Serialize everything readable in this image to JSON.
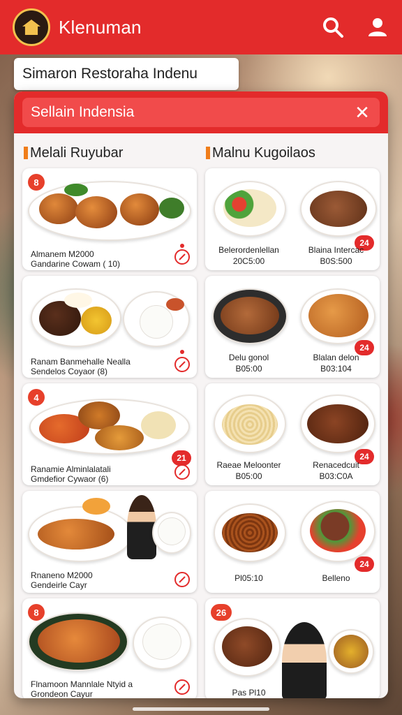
{
  "header": {
    "title": "Klenuman"
  },
  "banner": {
    "text": "Simaron Restoraha Indenu"
  },
  "modal": {
    "title": "Sellain Indensia",
    "close_icon": "close-icon"
  },
  "columns": [
    {
      "title": "Melali Ruyubar"
    },
    {
      "title": "Malnu Kugoilaos"
    }
  ],
  "left_cards": [
    {
      "badge": "8",
      "line1": "Almanem M2000",
      "line2": "Gandarine Cowam ( 10)"
    },
    {
      "badge": "",
      "line1": "Ranam Banmehalle Nealla",
      "line2": "Sendelos Coyaor (8)"
    },
    {
      "badge": "4",
      "line1": "Ranamie Alminlalatali",
      "line2": "Gmdefior Cywaor (6)"
    },
    {
      "badge": "",
      "line1": "Rnaneno M2000",
      "line2": "Gendeirle Cayr"
    },
    {
      "badge": "8",
      "line1": "Flnamoon Mannlale Ntyid a",
      "line2": "Grondeon Cayur"
    }
  ],
  "right_cards": [
    {
      "badge": "",
      "line1": "Belerordenlellan",
      "line2": "20C5:00",
      "line3": "Blaina Intercac",
      "line4": "B0S:500",
      "rbadge": "24"
    },
    {
      "badge": "",
      "line1": "Delu gonol",
      "line2": "B05:00",
      "line3": "Blalan delon",
      "line4": "B03:104",
      "rbadge": "24"
    },
    {
      "badge": "",
      "line1": "Raeae Meloonter",
      "line2": "B05:00",
      "line3": "Renacedcuit",
      "line4": "B03:C0A",
      "rbadge": "24"
    },
    {
      "badge": "",
      "line1": "Pl05:10",
      "line2": "",
      "line3": "Belleno",
      "line4": "",
      "rbadge": "24"
    },
    {
      "badge": "26",
      "line1": "Pas Pl10",
      "line2": "",
      "line3": "",
      "line4": "",
      "rbadge": ""
    }
  ],
  "colors": {
    "primary": "#e32b2b",
    "accent": "#f07d1a"
  }
}
